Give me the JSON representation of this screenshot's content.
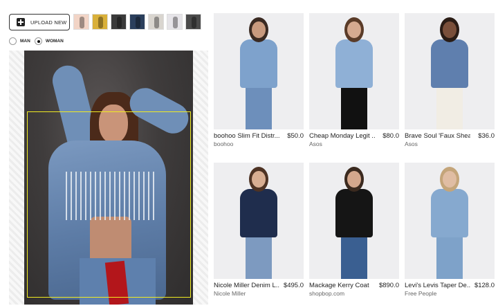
{
  "upload": {
    "label": "UPLOAD NEW"
  },
  "thumbnails": [
    {
      "color": "#f2d4c6"
    },
    {
      "color": "#d9b03a"
    },
    {
      "color": "#3a3a3a"
    },
    {
      "color": "#2b3f5c"
    },
    {
      "color": "#d9d5cf"
    },
    {
      "color": "#e6e4e8"
    },
    {
      "color": "#4b4b4b"
    }
  ],
  "gender": {
    "options": [
      "MAN",
      "WOMAN"
    ],
    "selected": "WOMAN"
  },
  "colors": {
    "selection_box": "#f2ec22",
    "card_bg": "#eeeef0"
  },
  "products": [
    {
      "name": "boohoo Slim Fit Distr...",
      "price": "$50.0",
      "brand": "boohoo",
      "jacket": "#7ea2cc",
      "legs": "#6d8fbb",
      "skin": "#c89a7e",
      "hair": "#3a2a22"
    },
    {
      "name": "Cheap Monday Legit ...",
      "price": "$80.0",
      "brand": "Asos",
      "jacket": "#8fb0d6",
      "legs": "#111111",
      "skin": "#d6aa90",
      "hair": "#5a3b28"
    },
    {
      "name": "Brave Soul 'Faux Shea...",
      "price": "$36.0",
      "brand": "Asos",
      "jacket": "#5f7fae",
      "legs": "#f1ede4",
      "skin": "#7a4f3a",
      "hair": "#2a1c15"
    },
    {
      "name": "Nicole Miller Denim L...",
      "price": "$495.0",
      "brand": "Nicole Miller",
      "jacket": "#1f2d4d",
      "legs": "#7d9ac0",
      "skin": "#d8ae92",
      "hair": "#4e3324"
    },
    {
      "name": "Mackage Kerry Coat",
      "price": "$890.0",
      "brand": "shopbop.com",
      "jacket": "#151515",
      "legs": "#3a5f91",
      "skin": "#d4a78c",
      "hair": "#3b2a1f"
    },
    {
      "name": "Levi's Levis Taper De...",
      "price": "$128.0",
      "brand": "Free People",
      "jacket": "#86a9cf",
      "legs": "#7ea2c9",
      "skin": "#e0bda3",
      "hair": "#c4a57a"
    }
  ]
}
